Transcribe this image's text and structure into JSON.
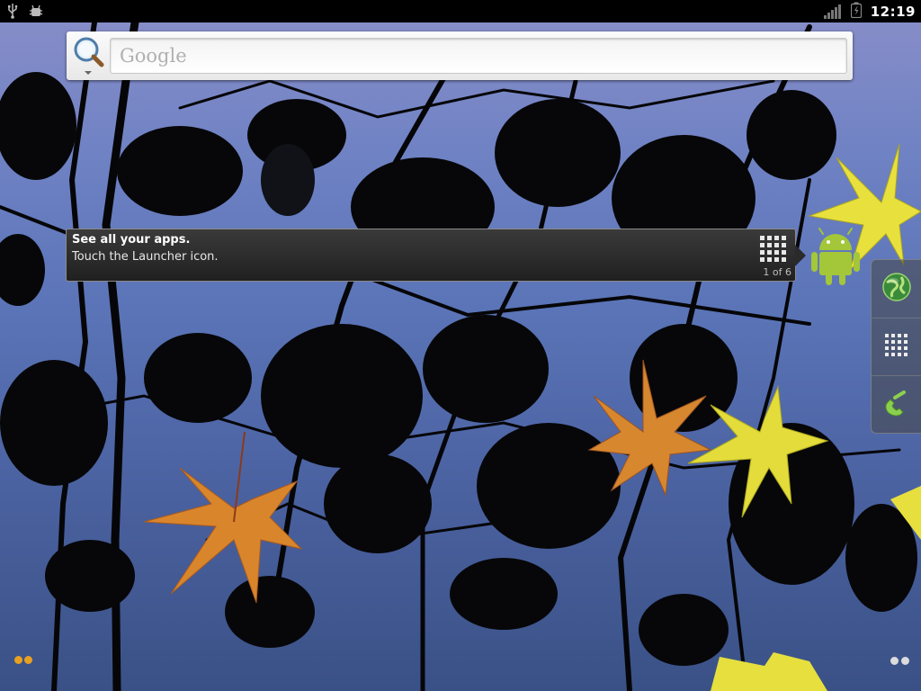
{
  "status_bar": {
    "time": "12:19",
    "left_icons": [
      "usb-icon",
      "debug-icon"
    ],
    "right_icons": [
      "signal-icon",
      "battery-icon"
    ]
  },
  "search": {
    "placeholder": "Google",
    "icon": "search-icon"
  },
  "hint": {
    "title": "See all your apps.",
    "body": "Touch the Launcher icon.",
    "page": "1 of 6",
    "icon": "launcher-grid-icon"
  },
  "dock": {
    "items": [
      {
        "name": "browser",
        "icon": "globe-icon"
      },
      {
        "name": "launcher",
        "icon": "app-grid-icon"
      },
      {
        "name": "phone",
        "icon": "phone-icon"
      }
    ]
  },
  "colors": {
    "status_bar": "#000000",
    "hint_background": "#2a2a2a",
    "android_green": "#a4c639"
  }
}
